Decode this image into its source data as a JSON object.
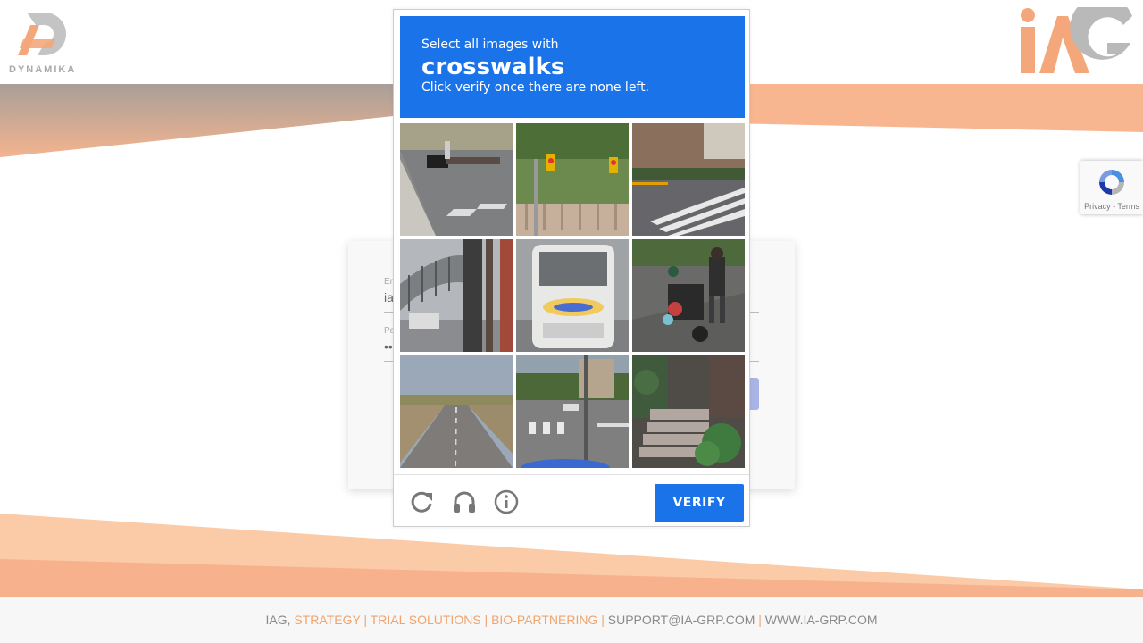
{
  "brand_left": {
    "name": "DYNAMIKA"
  },
  "brand_right": {
    "name": "IAG"
  },
  "login": {
    "email_label": "Er",
    "email_value": "ia",
    "password_label": "Pa",
    "password_value": "••"
  },
  "captcha": {
    "instruction_line1": "Select all images with",
    "keyword": "crosswalks",
    "instruction_line3": "Click verify once there are none left.",
    "verify_label": "VERIFY",
    "tiles": [
      {
        "subject": "street-with-parked-cars-and-crosswalk"
      },
      {
        "subject": "traffic-light-over-fence-and-trees"
      },
      {
        "subject": "street-crosswalk-near-shops"
      },
      {
        "subject": "overpass-with-railing"
      },
      {
        "subject": "rear-of-bus"
      },
      {
        "subject": "person-with-motorbike-on-sidewalk"
      },
      {
        "subject": "country-road"
      },
      {
        "subject": "road-intersection-with-crosswalk"
      },
      {
        "subject": "stone-stairs-with-plants"
      }
    ]
  },
  "recaptcha_badge": {
    "links": "Privacy - Terms"
  },
  "footer": {
    "prefix": "IAG,",
    "services": "STRATEGY | TRIAL SOLUTIONS | BIO-PARTNERING |",
    "email": "SUPPORT@IA-GRP.COM",
    "separator": "|",
    "website": "WWW.IA-GRP.COM"
  },
  "colors": {
    "accent": "#1a73e8",
    "brand_orange": "#f4a77b",
    "footer_bg": "#f7f7f7"
  }
}
